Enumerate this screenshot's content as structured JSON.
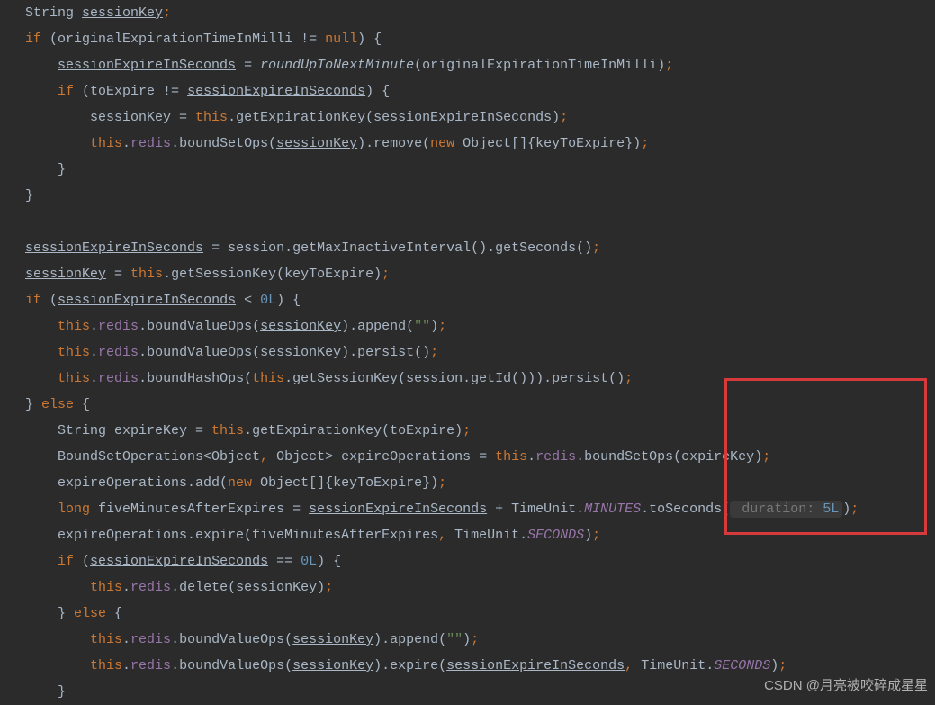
{
  "code": {
    "l1_a": "  String ",
    "l1_b": "sessionKey",
    "l1_c": ";",
    "l2_a": "  ",
    "l2_if": "if",
    "l2_b": " (originalExpirationTimeInMilli != ",
    "l2_null": "null",
    "l2_c": ") {",
    "l3_a": "      ",
    "l3_b": "sessionExpireInSeconds",
    "l3_c": " = ",
    "l3_d": "roundUpToNextMinute",
    "l3_e": "(originalExpirationTimeInMilli)",
    "l3_f": ";",
    "l4_a": "      ",
    "l4_if": "if",
    "l4_b": " (toExpire != ",
    "l4_c": "sessionExpireInSeconds",
    "l4_d": ") {",
    "l5_a": "          ",
    "l5_b": "sessionKey",
    "l5_c": " = ",
    "l5_this": "this",
    "l5_d": ".getExpirationKey(",
    "l5_e": "sessionExpireInSeconds",
    "l5_f": ")",
    "l5_g": ";",
    "l6_a": "          ",
    "l6_this": "this",
    "l6_b": ".",
    "l6_c": "redis",
    "l6_d": ".boundSetOps(",
    "l6_e": "sessionKey",
    "l6_f": ").remove(",
    "l6_new": "new",
    "l6_g": " Object[]{keyToExpire})",
    "l6_h": ";",
    "l7": "      }",
    "l8": "  }",
    "l9": "",
    "l10_a": "  ",
    "l10_b": "sessionExpireInSeconds",
    "l10_c": " = session.getMaxInactiveInterval().getSeconds()",
    "l10_d": ";",
    "l11_a": "  ",
    "l11_b": "sessionKey",
    "l11_c": " = ",
    "l11_this": "this",
    "l11_d": ".getSessionKey(keyToExpire)",
    "l11_e": ";",
    "l12_a": "  ",
    "l12_if": "if",
    "l12_b": " (",
    "l12_c": "sessionExpireInSeconds",
    "l12_d": " < ",
    "l12_e": "0L",
    "l12_f": ") {",
    "l13_a": "      ",
    "l13_this": "this",
    "l13_b": ".",
    "l13_c": "redis",
    "l13_d": ".boundValueOps(",
    "l13_e": "sessionKey",
    "l13_f": ").append(",
    "l13_g": "\"\"",
    "l13_h": ")",
    "l13_i": ";",
    "l14_a": "      ",
    "l14_this": "this",
    "l14_b": ".",
    "l14_c": "redis",
    "l14_d": ".boundValueOps(",
    "l14_e": "sessionKey",
    "l14_f": ").persist()",
    "l14_g": ";",
    "l15_a": "      ",
    "l15_this": "this",
    "l15_b": ".",
    "l15_c": "redis",
    "l15_d": ".boundHashOps(",
    "l15_this2": "this",
    "l15_e": ".getSessionKey(session.getId())).persist()",
    "l15_f": ";",
    "l16_a": "  } ",
    "l16_else": "else",
    "l16_b": " {",
    "l17_a": "      String expireKey = ",
    "l17_this": "this",
    "l17_b": ".getExpirationKey(toExpire)",
    "l17_c": ";",
    "l18_a": "      BoundSetOperations<Object",
    "l18_b": ",",
    "l18_c": " Object> expireOperations = ",
    "l18_this": "this",
    "l18_d": ".",
    "l18_e": "redis",
    "l18_f": ".boundSetOps(expireKey)",
    "l18_g": ";",
    "l19_a": "      expireOperations.add(",
    "l19_new": "new",
    "l19_b": " Object[]{keyToExpire})",
    "l19_c": ";",
    "l20_a": "      ",
    "l20_long": "long",
    "l20_b": " fiveMinutesAfterExpires = ",
    "l20_c": "sessionExpireInSeconds",
    "l20_d": " + TimeUnit.",
    "l20_e": "MINUTES",
    "l20_f": ".toSeconds(",
    "l20_hint_label": " duration: ",
    "l20_hint_val": "5L",
    "l20_g": ")",
    "l20_h": ";",
    "l21_a": "      expireOperations.expire(fiveMinutesAfterExpires",
    "l21_b": ",",
    "l21_c": " TimeUnit.",
    "l21_d": "SECONDS",
    "l21_e": ")",
    "l21_f": ";",
    "l22_a": "      ",
    "l22_if": "if",
    "l22_b": " (",
    "l22_c": "sessionExpireInSeconds",
    "l22_d": " == ",
    "l22_e": "0L",
    "l22_f": ") {",
    "l23_a": "          ",
    "l23_this": "this",
    "l23_b": ".",
    "l23_c": "redis",
    "l23_d": ".delete(",
    "l23_e": "sessionKey",
    "l23_f": ")",
    "l23_g": ";",
    "l24_a": "      } ",
    "l24_else": "else",
    "l24_b": " {",
    "l25_a": "          ",
    "l25_this": "this",
    "l25_b": ".",
    "l25_c": "redis",
    "l25_d": ".boundValueOps(",
    "l25_e": "sessionKey",
    "l25_f": ").append(",
    "l25_g": "\"\"",
    "l25_h": ")",
    "l25_i": ";",
    "l26_a": "          ",
    "l26_this": "this",
    "l26_b": ".",
    "l26_c": "redis",
    "l26_d": ".boundValueOps(",
    "l26_e": "sessionKey",
    "l26_f": ").expire(",
    "l26_g": "sessionExpireInSeconds",
    "l26_h": ",",
    "l26_i": " TimeUnit.",
    "l26_j": "SECONDS",
    "l26_k": ")",
    "l26_l": ";",
    "l27": "      }"
  },
  "watermark": "CSDN @月亮被咬碎成星星"
}
